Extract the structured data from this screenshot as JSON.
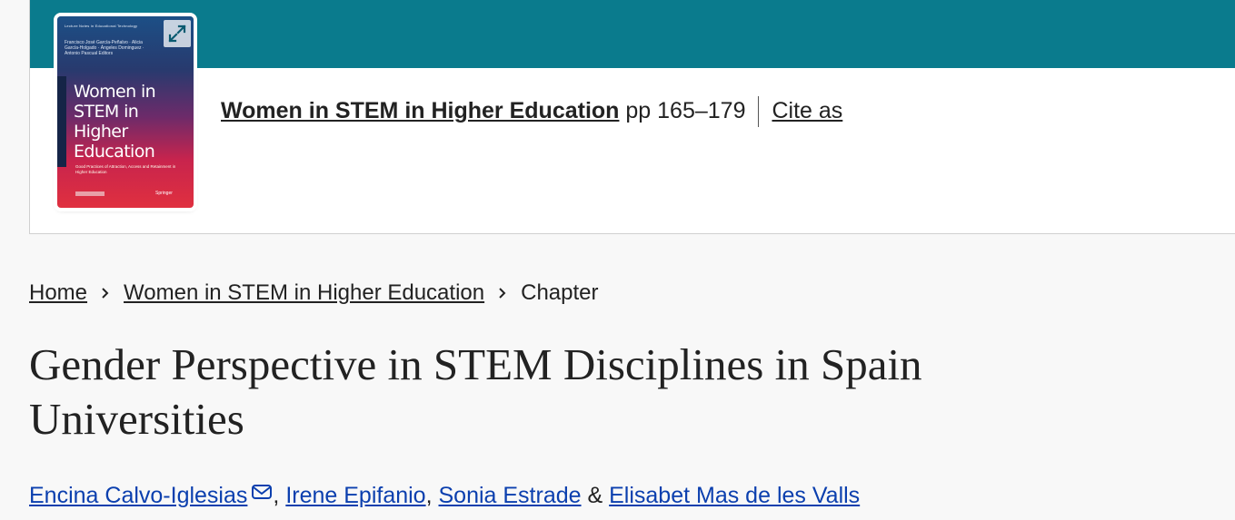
{
  "book": {
    "title": "Women in STEM in Higher Education",
    "pages": " pp 165–179",
    "cite_label": "Cite as",
    "cover": {
      "series": "Lecture Notes in Educational Technology",
      "editors": "Francisco José García-Peñalvo · Alicia García-Holgado · Ángeles Dominguez · Antonio Pascual  Editors",
      "title": "Women in STEM in Higher Education",
      "subtitle": "Good Practices of Attraction, Access and Retainment in Higher Education",
      "publisher": "Springer"
    },
    "colors": {
      "band": "#0a7b8d"
    }
  },
  "breadcrumb": {
    "home": "Home",
    "book": "Women in STEM in Higher Education",
    "current": "Chapter"
  },
  "article": {
    "title": "Gender Perspective in STEM Disciplines in Spain Universities"
  },
  "authors": {
    "list": [
      "Encina Calvo-Iglesias",
      "Irene Epifanio",
      "Sonia Estrade",
      "Elisabet Mas de les Valls"
    ],
    "separator": ", ",
    "last_separator": " & "
  },
  "colors": {
    "link": "#0b3fae",
    "text": "#222222"
  }
}
